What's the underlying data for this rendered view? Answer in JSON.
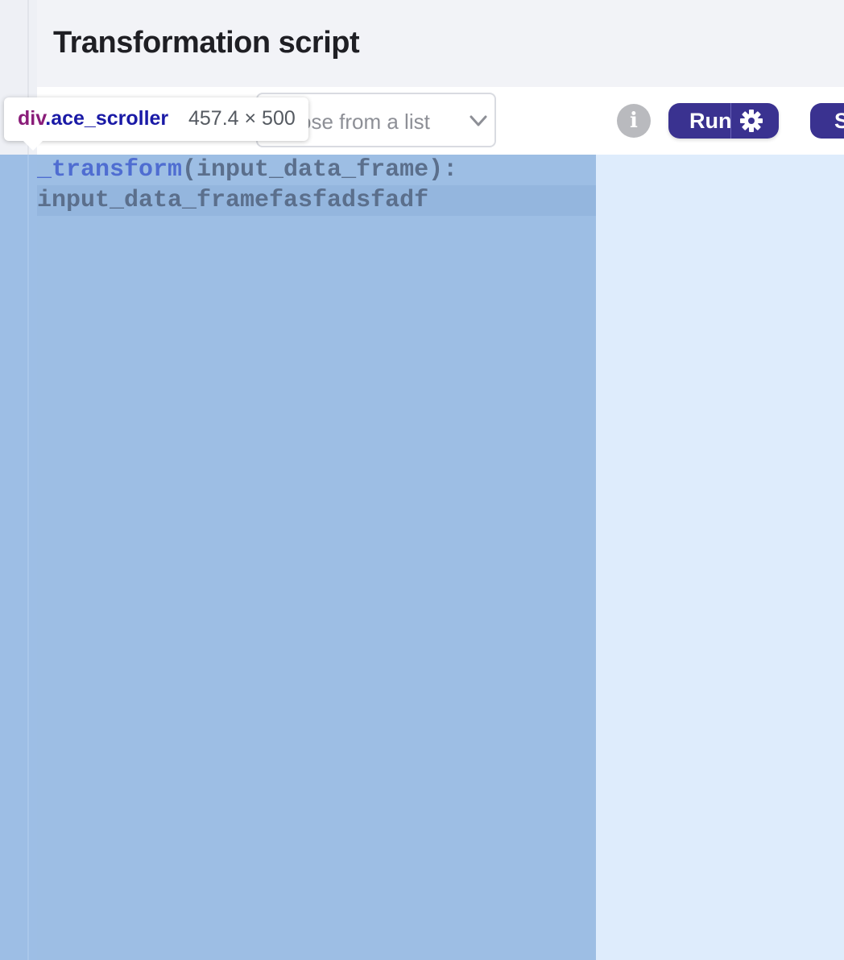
{
  "page": {
    "title": "Transformation script"
  },
  "toolbar": {
    "select_placeholder": "Choose from a list",
    "select_visible_text": "ose from a list",
    "info_label": "i",
    "run_label": "Run",
    "save_label": "S"
  },
  "editor": {
    "lines": [
      {
        "fn": "_transform",
        "rest": "(input_data_frame):"
      },
      {
        "text": "input_data_framefasfadsfadf"
      }
    ]
  },
  "inspector_tooltip": {
    "tag": "div",
    "class": ".ace_scroller",
    "size": "457.4 × 500"
  },
  "colors": {
    "accent": "#3a3290",
    "selection": "#9dbee4",
    "tooltip_tag": "#8a1d79",
    "tooltip_class": "#1a1aa6"
  }
}
